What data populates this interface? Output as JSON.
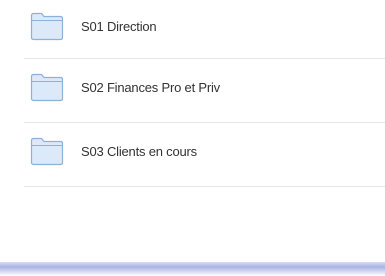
{
  "folders": [
    {
      "name": "S01 Direction",
      "icon": "folder-icon"
    },
    {
      "name": "S02 Finances Pro et Priv",
      "icon": "folder-icon"
    },
    {
      "name": "S03 Clients en cours",
      "icon": "folder-icon"
    }
  ],
  "colors": {
    "folder_fill": "#dbe9f8",
    "folder_stroke": "#8fb1d6",
    "divider": "#e6e6e6",
    "accent_bar": "#a9b4e4"
  }
}
